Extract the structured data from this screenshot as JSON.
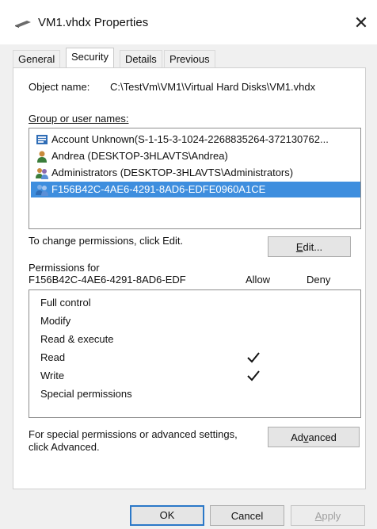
{
  "window": {
    "title": "VM1.vhdx Properties",
    "close_glyph": "✕"
  },
  "tabs": [
    {
      "label": "General"
    },
    {
      "label": "Security"
    },
    {
      "label": "Details"
    },
    {
      "label": "Previous Versions"
    }
  ],
  "object_name": {
    "label": "Object name:",
    "value": "C:\\TestVm\\VM1\\Virtual Hard Disks\\VM1.vhdx"
  },
  "group_label": "Group or user names:",
  "users": [
    {
      "name": "Account Unknown(S-1-15-3-1024-2268835264-372130762...",
      "icon": "unknown-account-icon"
    },
    {
      "name": "Andrea (DESKTOP-3HLAVTS\\Andrea)",
      "icon": "user-icon"
    },
    {
      "name": "Administrators (DESKTOP-3HLAVTS\\Administrators)",
      "icon": "group-icon"
    },
    {
      "name": "F156B42C-4AE6-4291-8AD6-EDFE0960A1CE",
      "icon": "group-icon",
      "selected": true
    }
  ],
  "edit_hint": "To change permissions, click Edit.",
  "edit_button": {
    "pre": "",
    "accel": "E",
    "post": "dit..."
  },
  "permissions": {
    "for_label": "Permissions for",
    "for_name": "F156B42C-4AE6-4291-8AD6-EDF",
    "allow_header": "Allow",
    "deny_header": "Deny",
    "rows": [
      {
        "label": "Full control",
        "allow": false
      },
      {
        "label": "Modify",
        "allow": false
      },
      {
        "label": "Read & execute",
        "allow": false
      },
      {
        "label": "Read",
        "allow": true
      },
      {
        "label": "Write",
        "allow": true
      },
      {
        "label": "Special permissions",
        "allow": false
      }
    ]
  },
  "advanced_hint": {
    "line1": "For special permissions or advanced settings,",
    "line2": "click Advanced."
  },
  "advanced_button": {
    "pre": "Ad",
    "accel": "v",
    "post": "anced"
  },
  "footer": {
    "ok": "OK",
    "cancel": "Cancel",
    "apply_accel": "A",
    "apply_rest": "pply"
  },
  "colors": {
    "selection": "#3e8ede",
    "window_bg": "#f0f0f0",
    "default_button_border": "#2b78c8"
  }
}
